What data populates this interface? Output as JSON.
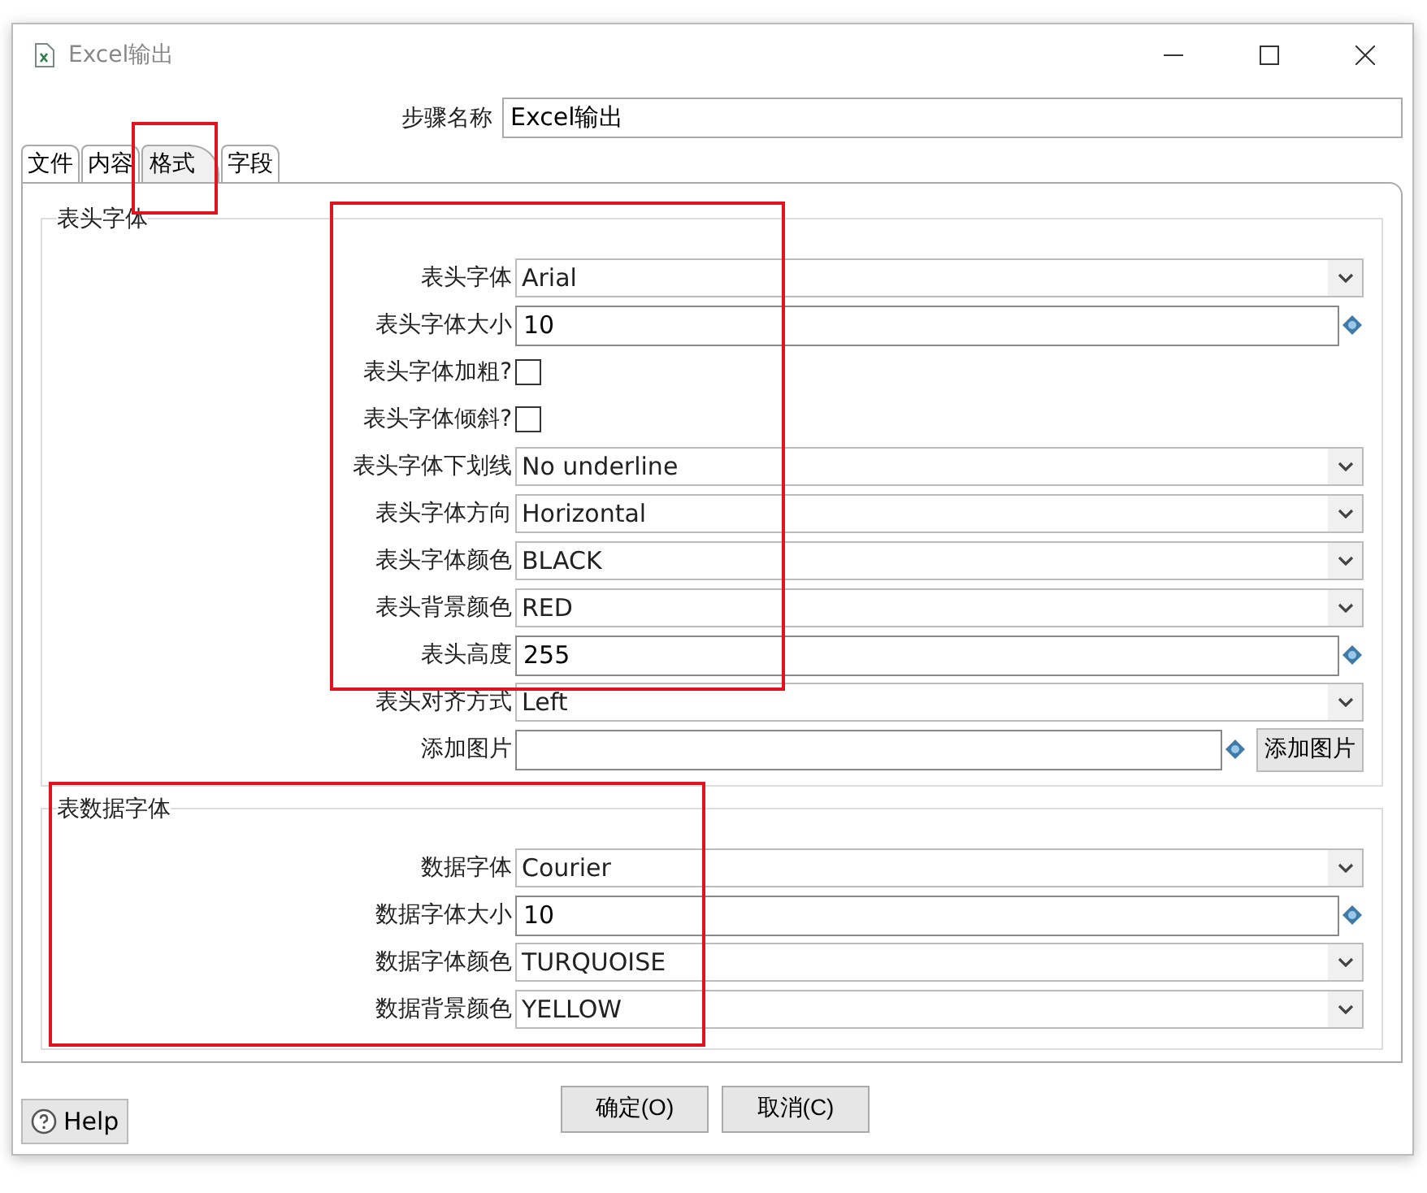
{
  "window": {
    "title": "Excel输出"
  },
  "step_name": {
    "label": "步骤名称",
    "value": "Excel输出"
  },
  "tabs": [
    {
      "label": "文件",
      "selected": false,
      "highlighted": false
    },
    {
      "label": "内容",
      "selected": false,
      "highlighted": false
    },
    {
      "label": "格式",
      "selected": true,
      "highlighted": true
    },
    {
      "label": "字段",
      "selected": false,
      "highlighted": false
    }
  ],
  "groups": [
    {
      "title": "表头字体",
      "highlighted": true,
      "rows": [
        {
          "kind": "combo",
          "label": "表头字体",
          "value": "Arial"
        },
        {
          "kind": "text",
          "label": "表头字体大小",
          "value": "10"
        },
        {
          "kind": "checkbox",
          "label": "表头字体加粗?",
          "checked": false
        },
        {
          "kind": "checkbox",
          "label": "表头字体倾斜?",
          "checked": false
        },
        {
          "kind": "combo",
          "label": "表头字体下划线",
          "value": "No underline"
        },
        {
          "kind": "combo",
          "label": "表头字体方向",
          "value": "Horizontal"
        },
        {
          "kind": "combo",
          "label": "表头字体颜色",
          "value": "BLACK"
        },
        {
          "kind": "combo",
          "label": "表头背景颜色",
          "value": "RED"
        },
        {
          "kind": "text",
          "label": "表头高度",
          "value": "255"
        },
        {
          "kind": "combo",
          "label": "表头对齐方式",
          "value": "Left"
        },
        {
          "kind": "file",
          "label": "添加图片",
          "button": "添加图片"
        }
      ]
    },
    {
      "title": "表数据字体",
      "highlighted": true,
      "rows": [
        {
          "kind": "combo",
          "label": "数据字体",
          "value": "Courier"
        },
        {
          "kind": "text",
          "label": "数据字体大小",
          "value": "10"
        },
        {
          "kind": "combo",
          "label": "数据字体颜色",
          "value": "TURQUOISE"
        },
        {
          "kind": "combo",
          "label": "数据背景颜色",
          "value": "YELLOW"
        }
      ]
    }
  ],
  "buttons": [
    "确定(O)",
    "取消(C)"
  ],
  "help": "Help"
}
